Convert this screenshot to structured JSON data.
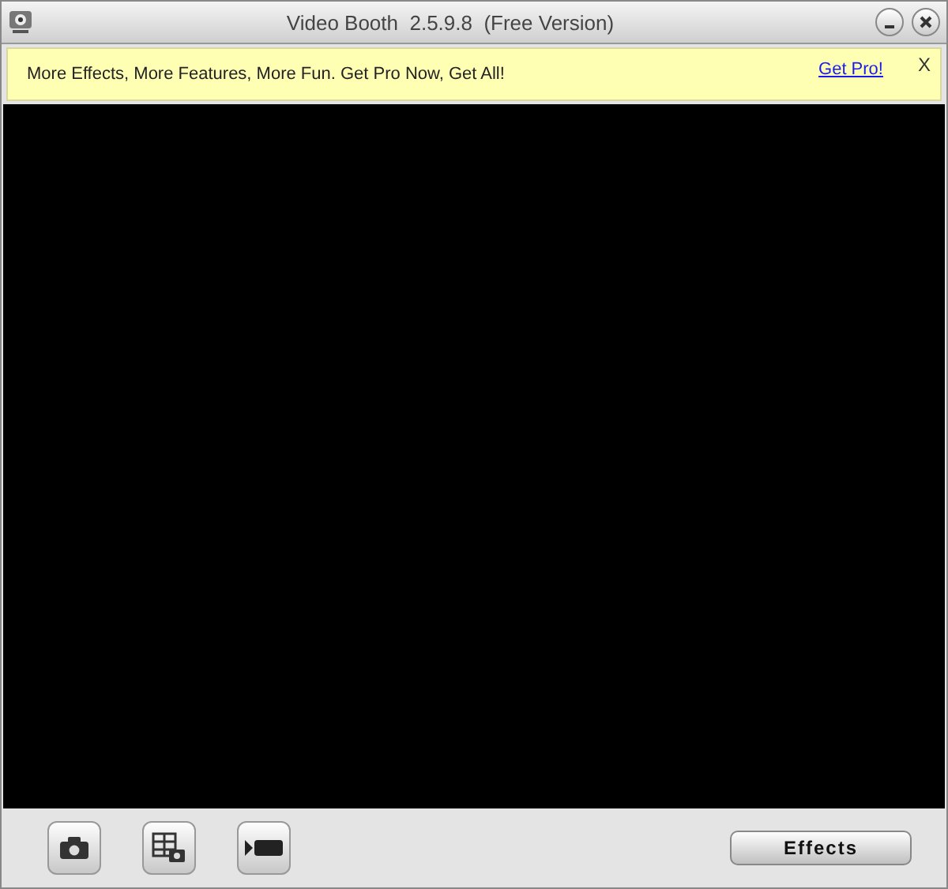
{
  "window": {
    "title": "Video Booth  2.5.9.8  (Free Version)"
  },
  "banner": {
    "message": "More Effects, More Features, More Fun. Get Pro Now, Get All!",
    "link": "Get Pro!",
    "close": "X"
  },
  "toolbar": {
    "buttons": [
      {
        "kind": "photo"
      },
      {
        "kind": "multi"
      },
      {
        "kind": "video"
      }
    ],
    "effects": "Effects"
  }
}
